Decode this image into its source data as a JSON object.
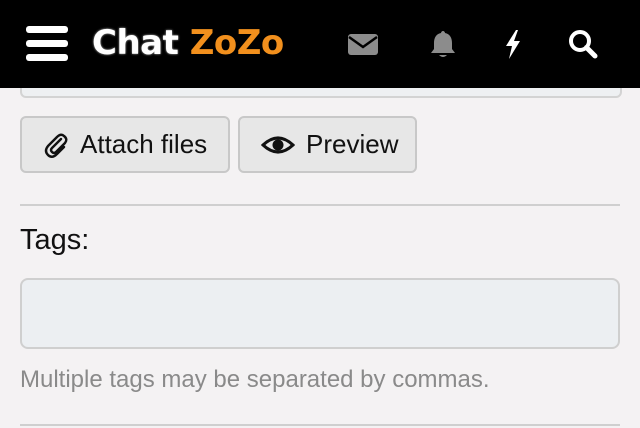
{
  "header": {
    "logo_word1": "Chat",
    "logo_word2": "ZoZo",
    "icons": [
      "menu-icon",
      "envelope-icon",
      "bell-icon",
      "bolt-icon",
      "search-icon"
    ],
    "colors": {
      "background": "#000000",
      "logo_accent": "#f2901d",
      "icon_gray": "#8c8c8c"
    }
  },
  "editor": {
    "attach_label": "Attach files",
    "preview_label": "Preview",
    "icons": [
      "paperclip-icon",
      "eye-icon"
    ]
  },
  "tags": {
    "label": "Tags:",
    "value": "",
    "placeholder": "",
    "hint": "Multiple tags may be separated by commas."
  }
}
